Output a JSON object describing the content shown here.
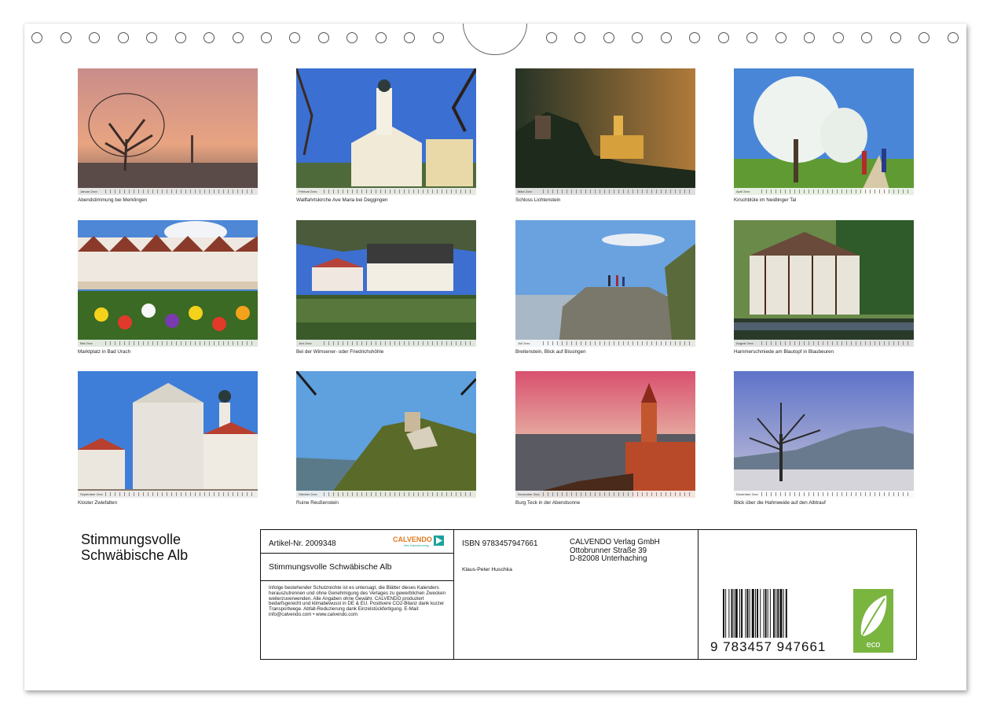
{
  "calendar": {
    "title_line1": "Stimmungsvolle",
    "title_line2": "Schwäbische Alb"
  },
  "months": [
    {
      "month": "Januar 2xxx",
      "caption": "Abendstimmung bei Merklingen",
      "photo": "bare tree in sunset fog"
    },
    {
      "month": "Februar 2xxx",
      "caption": "Wallfahrtskirche Ave Maria bei Deggingen",
      "photo": "baroque pilgrimage church"
    },
    {
      "month": "März 2xxx",
      "caption": "Schloss Lichtenstein",
      "photo": "castle on rock at dusk"
    },
    {
      "month": "April 2xxx",
      "caption": "Kirschblüte im Neidlinger Tal",
      "photo": "cherry blossom tree with hikers"
    },
    {
      "month": "Mai 2xxx",
      "caption": "Marktplatz in Bad Urach",
      "photo": "half-timbered houses and flowers"
    },
    {
      "month": "Juni 2xxx",
      "caption": "Bei der Wimsener- oder Friedrichshöhle",
      "photo": "mill house by pond"
    },
    {
      "month": "Juli 2xxx",
      "caption": "Breitenstein, Blick auf Bissingen",
      "photo": "rock cliff viewpoint"
    },
    {
      "month": "August 2xxx",
      "caption": "Hammerschmiede am Blautopf in Blaubeuren",
      "photo": "half-timbered hammer mill"
    },
    {
      "month": "September 2xxx",
      "caption": "Kloster Zwiefalten",
      "photo": "baroque monastery church"
    },
    {
      "month": "Oktober 2xxx",
      "caption": "Ruine Reußenstein",
      "photo": "castle ruin on forested cliff"
    },
    {
      "month": "November 2xxx",
      "caption": "Burg Teck in der Abendsonne",
      "photo": "castle tower at sunset"
    },
    {
      "month": "Dezember 2xxx",
      "caption": "Blick über die Hahnweide auf den Albtrauf",
      "photo": "bare tree in frosty field"
    }
  ],
  "info": {
    "artikel": "Artikel-Nr. 2009348",
    "title": "Stimmungsvolle Schwäbische Alb",
    "isbn": "ISBN 9783457947661",
    "author": "Klaus-Peter Huschka",
    "publisher_lines": [
      "CALVENDO Verlag GmbH",
      "Ottobrunner Straße 39",
      "D-82008 Unterhaching"
    ],
    "legal": "Infolge bestehender Schutzrechte ist es untersagt, die Blätter dieses Kalenders herauszutrennen und ohne Genehmigung des Verlages zu gewerblichen Zwecken weiterzuverwenden. Alle Angaben ohne Gewähr. CALVENDO produziert bedarfsgerecht und klimabewusst in DE & EU. Positivere CO2-Bilanz dank kurzer Transportwege. Abfall-Reduzierung dank Einzelstückfertigung. E-Mail: info@calvendo.com • www.calvendo.com",
    "barcode_number": "9   783457   947661",
    "logo_text": "CALVENDO",
    "logo_tagline": "Dein Kalenderverlag",
    "eco_label": "eco"
  },
  "colors": {
    "page": "#ffffff",
    "border": "#111111",
    "eco_green": "#7ab540",
    "calvendo_orange": "#e07a1f",
    "calvendo_teal": "#1aa39a"
  }
}
